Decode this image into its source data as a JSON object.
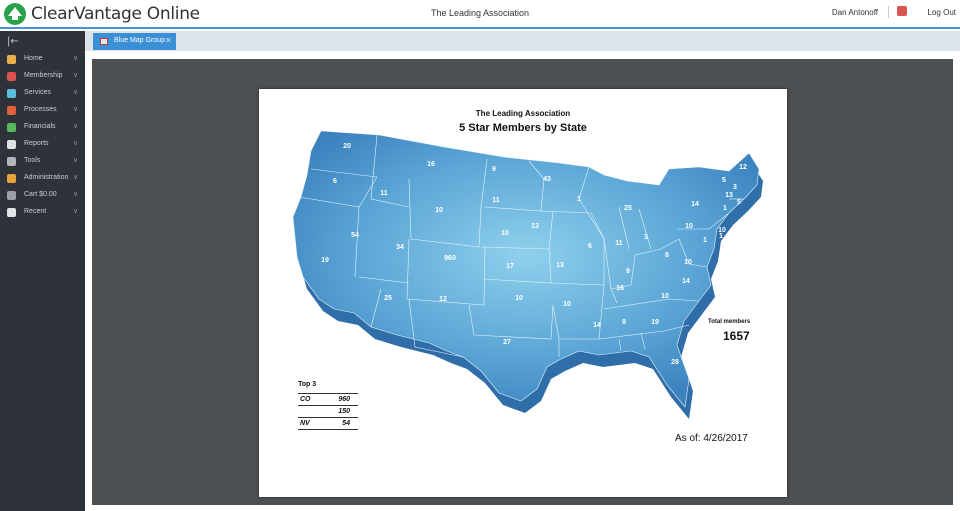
{
  "app": {
    "title": "ClearVantage Online",
    "organization": "The Leading Association",
    "user_name": "Dan Antonoff",
    "logout_label": "Log Out",
    "accent": "#4a90d9",
    "logo_color": "#2aa24a"
  },
  "sidebar": {
    "collapse_icon": "collapse-sidebar-icon",
    "items": [
      {
        "label": "Home",
        "icon": "home-icon",
        "color": "#e8b04a"
      },
      {
        "label": "Membership",
        "icon": "membership-icon",
        "color": "#d9534f"
      },
      {
        "label": "Services",
        "icon": "services-icon",
        "color": "#5bc0de"
      },
      {
        "label": "Processes",
        "icon": "processes-icon",
        "color": "#e0603a"
      },
      {
        "label": "Financials",
        "icon": "financials-icon",
        "color": "#5cb85c"
      },
      {
        "label": "Reports",
        "icon": "reports-icon",
        "color": "#dfe3e6"
      },
      {
        "label": "Tools",
        "icon": "tools-icon",
        "color": "#b0b5ba"
      },
      {
        "label": "Administration",
        "icon": "administration-icon",
        "color": "#e8a23a"
      },
      {
        "label": "Cart $0.00",
        "icon": "cart-icon",
        "color": "#9aa0a6"
      },
      {
        "label": "Recent",
        "icon": "recent-icon",
        "color": "#dfe3e6"
      }
    ]
  },
  "tabs": [
    {
      "label": "Blue Map Group",
      "active": true
    }
  ],
  "report": {
    "title": "The Leading Association",
    "subtitle": "5 Star Members by State",
    "total_label": "Total members",
    "total_value": "1657",
    "as_of": "As of: 4/26/2017",
    "top3_heading": "Top 3",
    "top3": [
      {
        "state": "CO",
        "count": "960"
      },
      {
        "state": "",
        "count": "150"
      },
      {
        "state": "NV",
        "count": "54"
      }
    ],
    "map_color": "#5ba6d6",
    "state_values": [
      "20",
      "16",
      "9",
      "43",
      "12",
      "6",
      "11",
      "10",
      "11",
      "1",
      "25",
      "14",
      "5",
      "3",
      "13",
      "5",
      "1",
      "10",
      "54",
      "34",
      "960",
      "10",
      "13",
      "6",
      "11",
      "3",
      "10",
      "1",
      "19",
      "17",
      "13",
      "9",
      "8",
      "1",
      "10",
      "25",
      "12",
      "10",
      "10",
      "16",
      "14",
      "10",
      "14",
      "9",
      "19",
      "27",
      "28"
    ]
  }
}
